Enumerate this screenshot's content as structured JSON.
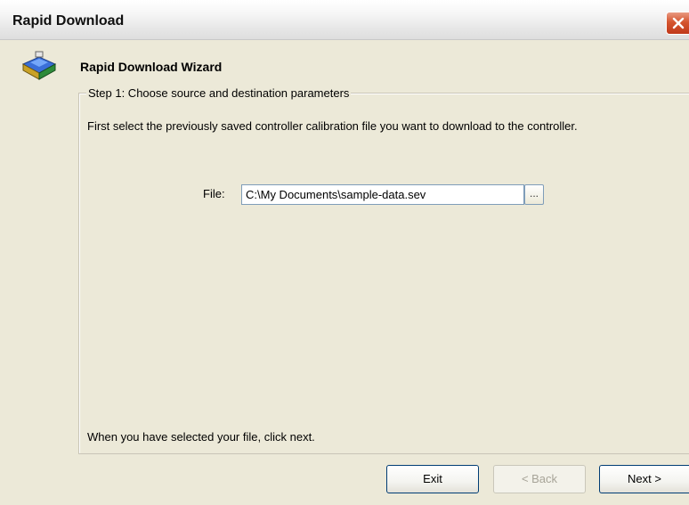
{
  "window": {
    "title": "Rapid Download"
  },
  "header": {
    "title": "Rapid Download Wizard",
    "icon": "chip-download-icon"
  },
  "step": {
    "legend": "Step 1: Choose source and destination parameters",
    "intro": "First select the previously saved controller calibration file you want to download to the controller.",
    "file_label": "File:",
    "file_value": "C:\\My Documents\\sample-data.sev",
    "browse_label": "...",
    "footer": "When you have selected your file, click next."
  },
  "buttons": {
    "exit": "Exit",
    "back": "< Back",
    "next": "Next >"
  },
  "colors": {
    "background": "#ece9d8",
    "close": "#d5552f",
    "input_border": "#7f9db9"
  }
}
